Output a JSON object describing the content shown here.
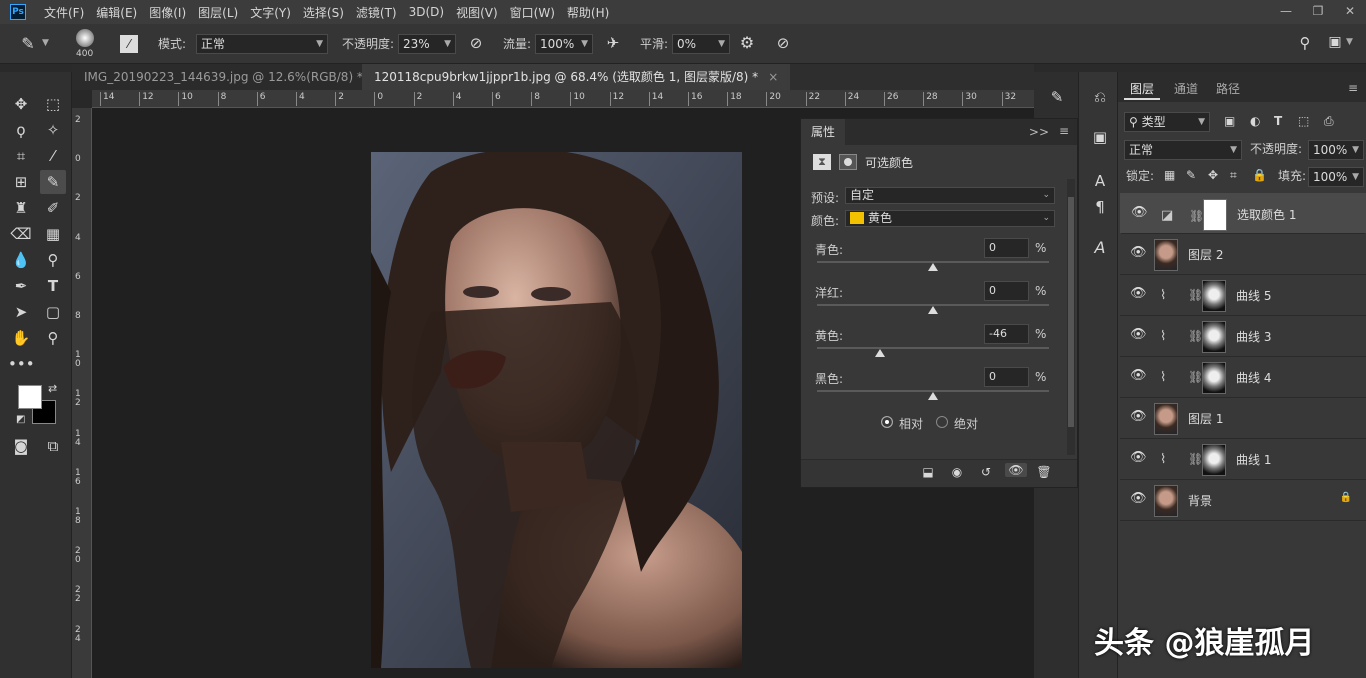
{
  "menu": {
    "ps_logo": "Ps",
    "items": [
      "文件(F)",
      "编辑(E)",
      "图像(I)",
      "图层(L)",
      "文字(Y)",
      "选择(S)",
      "滤镜(T)",
      "3D(D)",
      "视图(V)",
      "窗口(W)",
      "帮助(H)"
    ]
  },
  "window_controls": {
    "minimize": "—",
    "restore": "❐",
    "close": "✕"
  },
  "options": {
    "brush_size": "400",
    "mode_label": "模式:",
    "mode_value": "正常",
    "opacity_label": "不透明度:",
    "opacity_value": "23%",
    "flow_label": "流量:",
    "flow_value": "100%",
    "smooth_label": "平滑:",
    "smooth_value": "0%"
  },
  "tabs": [
    {
      "label": "IMG_20190223_144639.jpg @ 12.6%(RGB/8) *",
      "close": "×"
    },
    {
      "label": "120118cpu9brkw1jjppr1b.jpg @ 68.4% (选取颜色 1, 图层蒙版/8) *",
      "close": "×"
    }
  ],
  "hruler_labels": [
    "14",
    "12",
    "10",
    "8",
    "6",
    "4",
    "2",
    "0",
    "2",
    "4",
    "6",
    "8",
    "10",
    "12",
    "14",
    "16",
    "18",
    "20",
    "22",
    "24",
    "26",
    "28",
    "30",
    "32"
  ],
  "vruler_labels": [
    "2",
    "0",
    "2",
    "4",
    "6",
    "8",
    "10",
    "12",
    "14",
    "16",
    "18",
    "20",
    "22",
    "24"
  ],
  "properties": {
    "tab": "属性",
    "collapse": ">>",
    "title": "可选颜色",
    "preset_label": "预设:",
    "preset_value": "自定",
    "color_label": "颜色:",
    "color_value": "黄色",
    "color_swatch": "#f2c200",
    "sliders": [
      {
        "label": "青色:",
        "value": "0",
        "unit": "%",
        "pos": 0.5
      },
      {
        "label": "洋红:",
        "value": "0",
        "unit": "%",
        "pos": 0.5
      },
      {
        "label": "黄色:",
        "value": "-46",
        "unit": "%",
        "pos": 0.27
      },
      {
        "label": "黑色:",
        "value": "0",
        "unit": "%",
        "pos": 0.5
      }
    ],
    "relative": "相对",
    "absolute": "绝对"
  },
  "layers_panel": {
    "tabs": [
      "图层",
      "通道",
      "路径"
    ],
    "filter": "类型",
    "blend": "正常",
    "opacity_label": "不透明度:",
    "opacity_value": "100%",
    "lock_label": "锁定:",
    "fill_label": "填充:",
    "fill_value": "100%",
    "layers": [
      {
        "name": "选取颜色 1",
        "kind": "selective",
        "selected": true
      },
      {
        "name": "图层 2",
        "kind": "photo"
      },
      {
        "name": "曲线 5",
        "kind": "curves"
      },
      {
        "name": "曲线 3",
        "kind": "curves"
      },
      {
        "name": "曲线 4",
        "kind": "curves"
      },
      {
        "name": "图层 1",
        "kind": "photo"
      },
      {
        "name": "曲线 1",
        "kind": "curves"
      },
      {
        "name": "背景",
        "kind": "photo",
        "locked": true
      }
    ]
  },
  "watermark": "头条 @狼崖孤月"
}
